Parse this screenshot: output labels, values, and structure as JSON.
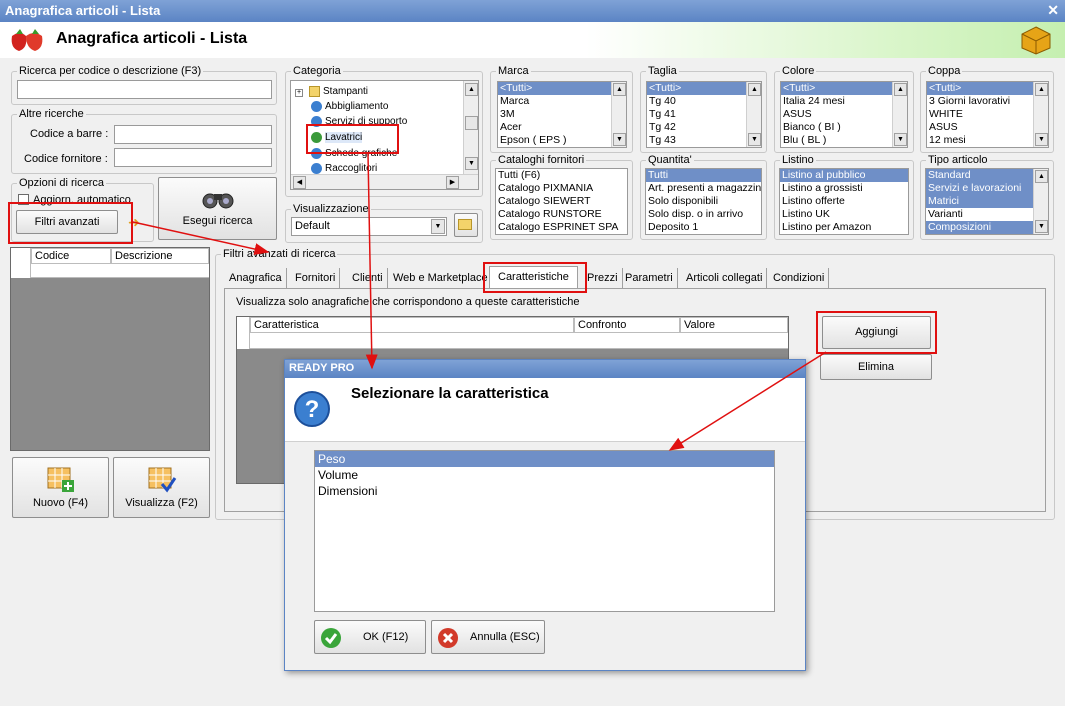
{
  "window": {
    "title": "Anagrafica articoli  - Lista",
    "header_title": "Anagrafica articoli  - Lista"
  },
  "search": {
    "group_label": "Ricerca per codice o descrizione (F3)",
    "value": "",
    "other_label": "Altre ricerche",
    "barcode_label": "Codice a barre :",
    "supplier_code_label": "Codice fornitore :",
    "options_label": "Opzioni di ricerca",
    "auto_update_label": "Aggiorn. automatico",
    "advanced_filters_button": "Filtri avanzati",
    "run_search_button": "Esegui ricerca"
  },
  "categoria": {
    "label": "Categoria",
    "items": [
      "Stampanti",
      "Abbigliamento",
      "Servizi di supporto",
      "Lavatrici",
      "Schede grafiche",
      "Raccoglitori"
    ]
  },
  "visualizzazione": {
    "label": "Visualizzazione",
    "value": "Default"
  },
  "filters": {
    "marca": {
      "label": "Marca",
      "items": [
        "<Tutti>",
        "Marca",
        "3M",
        "Acer",
        "Epson ( EPS )"
      ]
    },
    "taglia": {
      "label": "Taglia",
      "items": [
        "<Tutti>",
        "Tg 40",
        "Tg 41",
        "Tg 42",
        "Tg 43"
      ]
    },
    "colore": {
      "label": "Colore",
      "items": [
        "<Tutti>",
        "Italia 24 mesi",
        "ASUS",
        "Bianco ( BI )",
        "Blu ( BL )"
      ]
    },
    "coppa": {
      "label": "Coppa",
      "items": [
        "<Tutti>",
        "3 Giorni lavorativi",
        "WHITE",
        "ASUS",
        "12 mesi"
      ]
    },
    "cataloghi": {
      "label": "Cataloghi fornitori",
      "items": [
        "Tutti (F6)",
        "Catalogo PIXMANIA",
        "Catalogo SIEWERT",
        "Catalogo RUNSTORE",
        "Catalogo ESPRINET SPA"
      ]
    },
    "quantita": {
      "label": "Quantita'",
      "items": [
        "Tutti",
        "Art. presenti a magazzino",
        "Solo disponibili",
        "Solo disp. o in arrivo",
        "Deposito 1"
      ]
    },
    "listino": {
      "label": "Listino",
      "items": [
        "Listino al pubblico",
        "Listino a grossisti",
        "Listino offerte",
        "Listino UK",
        "Listino per Amazon"
      ]
    },
    "tipo": {
      "label": "Tipo articolo",
      "items": [
        "Standard",
        "Servizi e lavorazioni",
        "Matrici",
        "Varianti",
        "Composizioni"
      ]
    }
  },
  "result_grid": {
    "columns": [
      "Codice",
      "Descrizione"
    ]
  },
  "bottom_buttons": {
    "new": "Nuovo (F4)",
    "view": "Visualizza (F2)"
  },
  "advanced": {
    "label": "Filtri avanzati di ricerca",
    "tabs": [
      "Anagrafica",
      "Fornitori",
      "Clienti",
      "Web e Marketplace",
      "Caratteristiche",
      "Prezzi",
      "Parametri",
      "Articoli collegati",
      "Condizioni"
    ],
    "hint": "Visualizza solo anagrafiche che corrispondono a queste caratteristiche",
    "columns": [
      "Caratteristica",
      "Confronto",
      "Valore"
    ],
    "add_button": "Aggiungi",
    "delete_button": "Elimina"
  },
  "dialog": {
    "title": "READY PRO",
    "heading": "Selezionare la caratteristica",
    "items": [
      "Peso",
      "Volume",
      "Dimensioni"
    ],
    "ok_button": "OK (F12)",
    "cancel_button": "Annulla (ESC)"
  },
  "colors": {
    "titlebar": "#5b84c4",
    "selection": "#6f8fc7",
    "annotation": "#e01010"
  }
}
